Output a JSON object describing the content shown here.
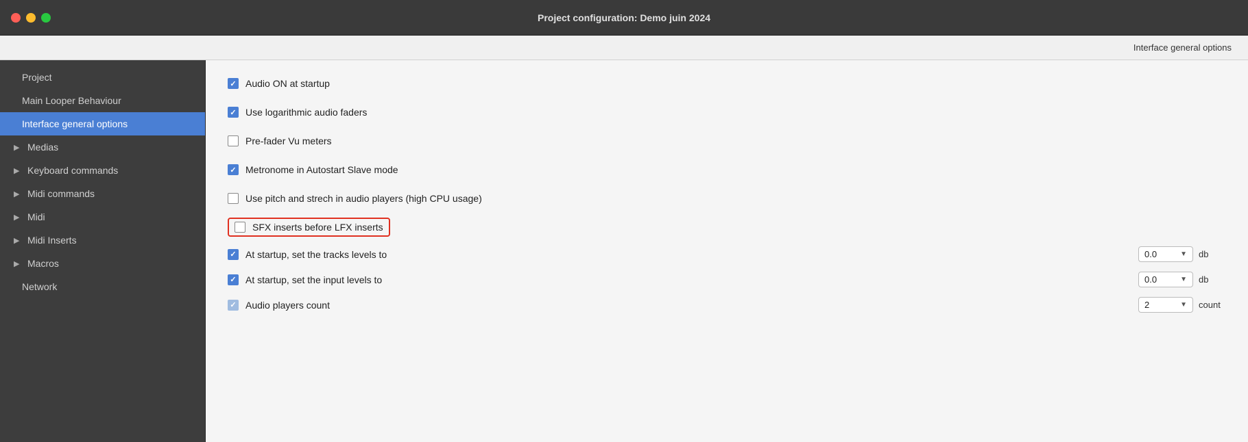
{
  "titleBar": {
    "title": "Project configuration: Demo juin 2024",
    "controls": {
      "close": "close",
      "minimize": "minimize",
      "maximize": "maximize"
    }
  },
  "subtitleBar": {
    "text": "Interface general options"
  },
  "sidebar": {
    "items": [
      {
        "id": "project",
        "label": "Project",
        "hasArrow": false,
        "active": false
      },
      {
        "id": "main-looper",
        "label": "Main Looper Behaviour",
        "hasArrow": false,
        "active": false
      },
      {
        "id": "interface-general",
        "label": "Interface general options",
        "hasArrow": false,
        "active": true
      },
      {
        "id": "medias",
        "label": "Medias",
        "hasArrow": true,
        "active": false
      },
      {
        "id": "keyboard-commands",
        "label": "Keyboard commands",
        "hasArrow": true,
        "active": false
      },
      {
        "id": "midi-commands",
        "label": "Midi commands",
        "hasArrow": true,
        "active": false
      },
      {
        "id": "midi",
        "label": "Midi",
        "hasArrow": true,
        "active": false
      },
      {
        "id": "midi-inserts",
        "label": "Midi Inserts",
        "hasArrow": true,
        "active": false
      },
      {
        "id": "macros",
        "label": "Macros",
        "hasArrow": true,
        "active": false
      },
      {
        "id": "network",
        "label": "Network",
        "hasArrow": false,
        "active": false
      }
    ]
  },
  "content": {
    "options": [
      {
        "id": "audio-on-startup",
        "label": "Audio ON at startup",
        "checked": true,
        "disabled": false,
        "highlighted": false
      },
      {
        "id": "log-audio-faders",
        "label": "Use logarithmic audio faders",
        "checked": true,
        "disabled": false,
        "highlighted": false
      },
      {
        "id": "pre-fader-vu",
        "label": "Pre-fader Vu meters",
        "checked": false,
        "disabled": false,
        "highlighted": false
      },
      {
        "id": "metronome-autostart",
        "label": "Metronome in Autostart Slave mode",
        "checked": true,
        "disabled": false,
        "highlighted": false
      },
      {
        "id": "pitch-stretch",
        "label": "Use pitch and strech in audio players (high CPU usage)",
        "checked": false,
        "disabled": false,
        "highlighted": false
      },
      {
        "id": "sfx-before-lfx",
        "label": "SFX inserts before LFX inserts",
        "checked": false,
        "disabled": false,
        "highlighted": true
      }
    ],
    "dropdownOptions": [
      {
        "id": "tracks-level",
        "label": "At startup, set the tracks levels to",
        "checked": true,
        "disabled": false,
        "value": "0.0",
        "unit": "db"
      },
      {
        "id": "input-level",
        "label": "At startup, set the input levels to",
        "checked": true,
        "disabled": false,
        "value": "0.0",
        "unit": "db"
      },
      {
        "id": "audio-players-count",
        "label": "Audio players count",
        "checked": true,
        "disabled": true,
        "value": "2",
        "unit": "count"
      }
    ]
  }
}
